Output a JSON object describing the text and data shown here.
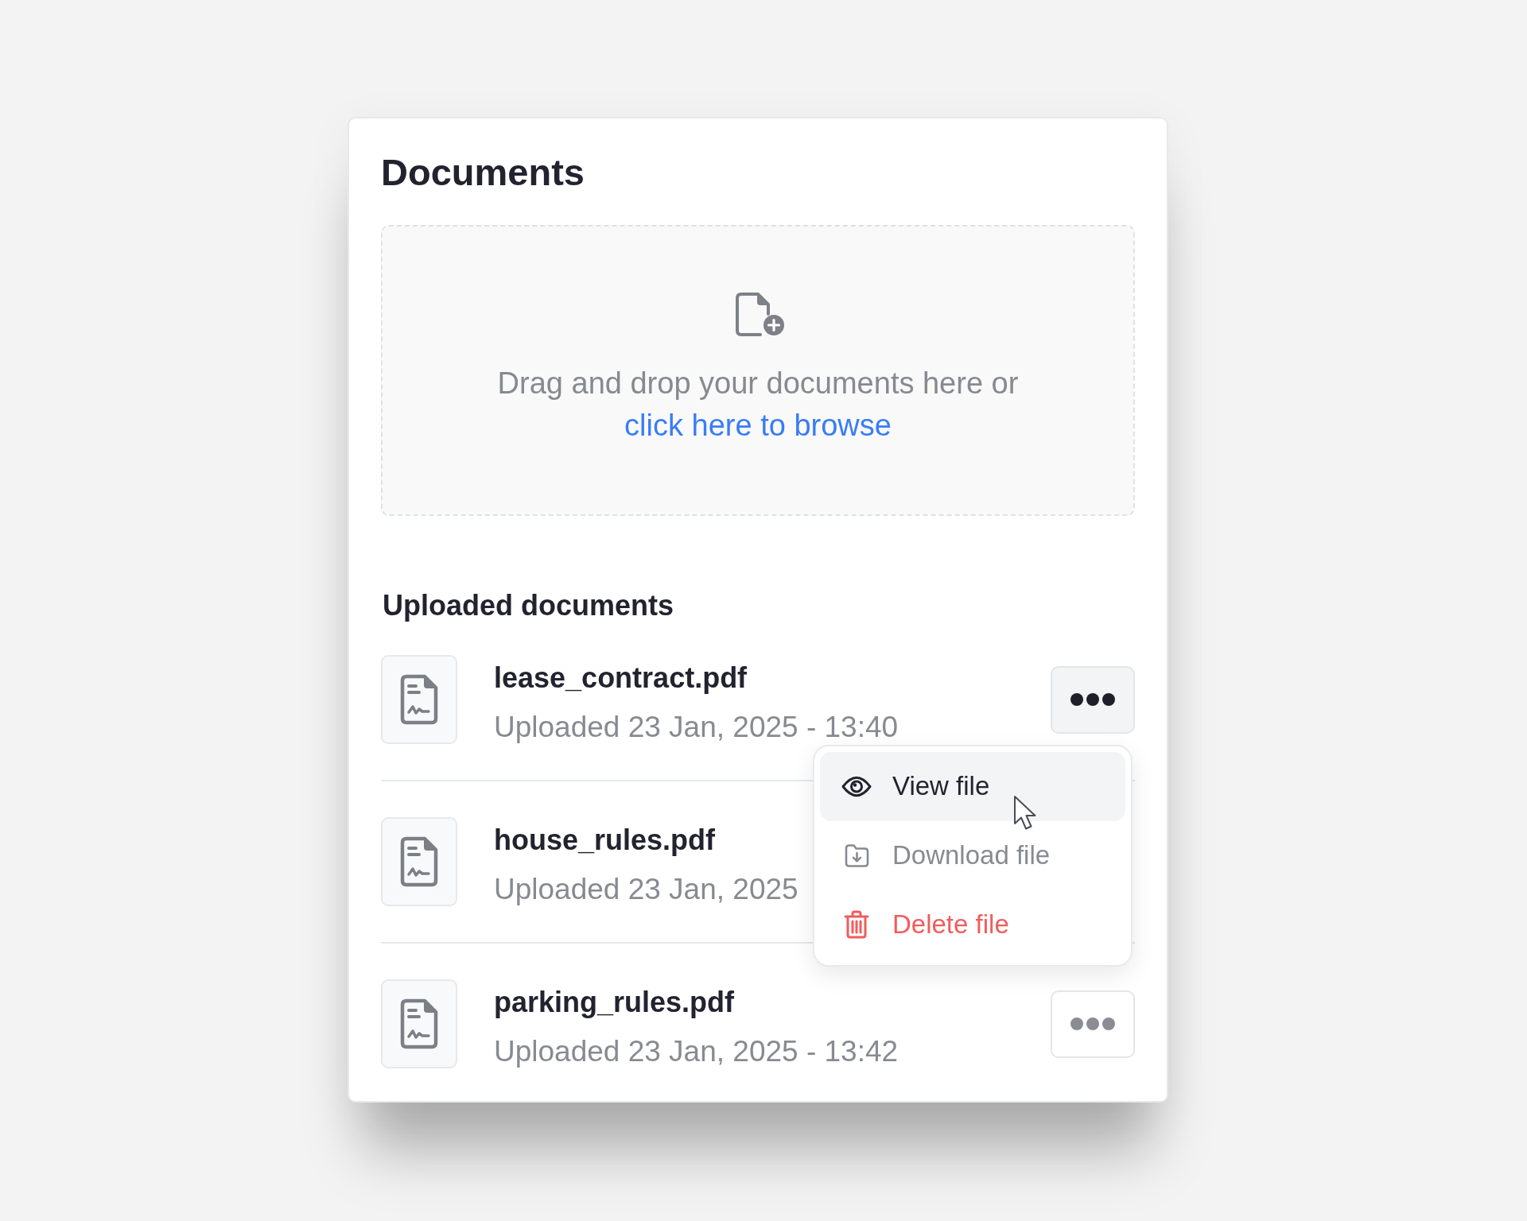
{
  "card": {
    "title": "Documents"
  },
  "dropzone": {
    "prompt": "Drag and drop your documents here or",
    "link": "click here to browse"
  },
  "uploaded": {
    "heading": "Uploaded documents",
    "files": [
      {
        "name": "lease_contract.pdf",
        "uploaded": "Uploaded 23 Jan, 2025 - 13:40",
        "actions_button": {
          "active": true
        }
      },
      {
        "name": "house_rules.pdf",
        "uploaded": "Uploaded 23 Jan, 2025"
      },
      {
        "name": "parking_rules.pdf",
        "uploaded": "Uploaded 23 Jan, 2025 - 13:42",
        "actions_button": {
          "active": false
        }
      }
    ]
  },
  "context_menu": {
    "items": [
      {
        "kind": "view",
        "label": "View file",
        "selected": true,
        "disabled": false
      },
      {
        "kind": "download",
        "label": "Download file",
        "selected": false,
        "disabled": true
      },
      {
        "kind": "delete",
        "label": "Delete file",
        "selected": false,
        "disabled": false
      }
    ]
  }
}
